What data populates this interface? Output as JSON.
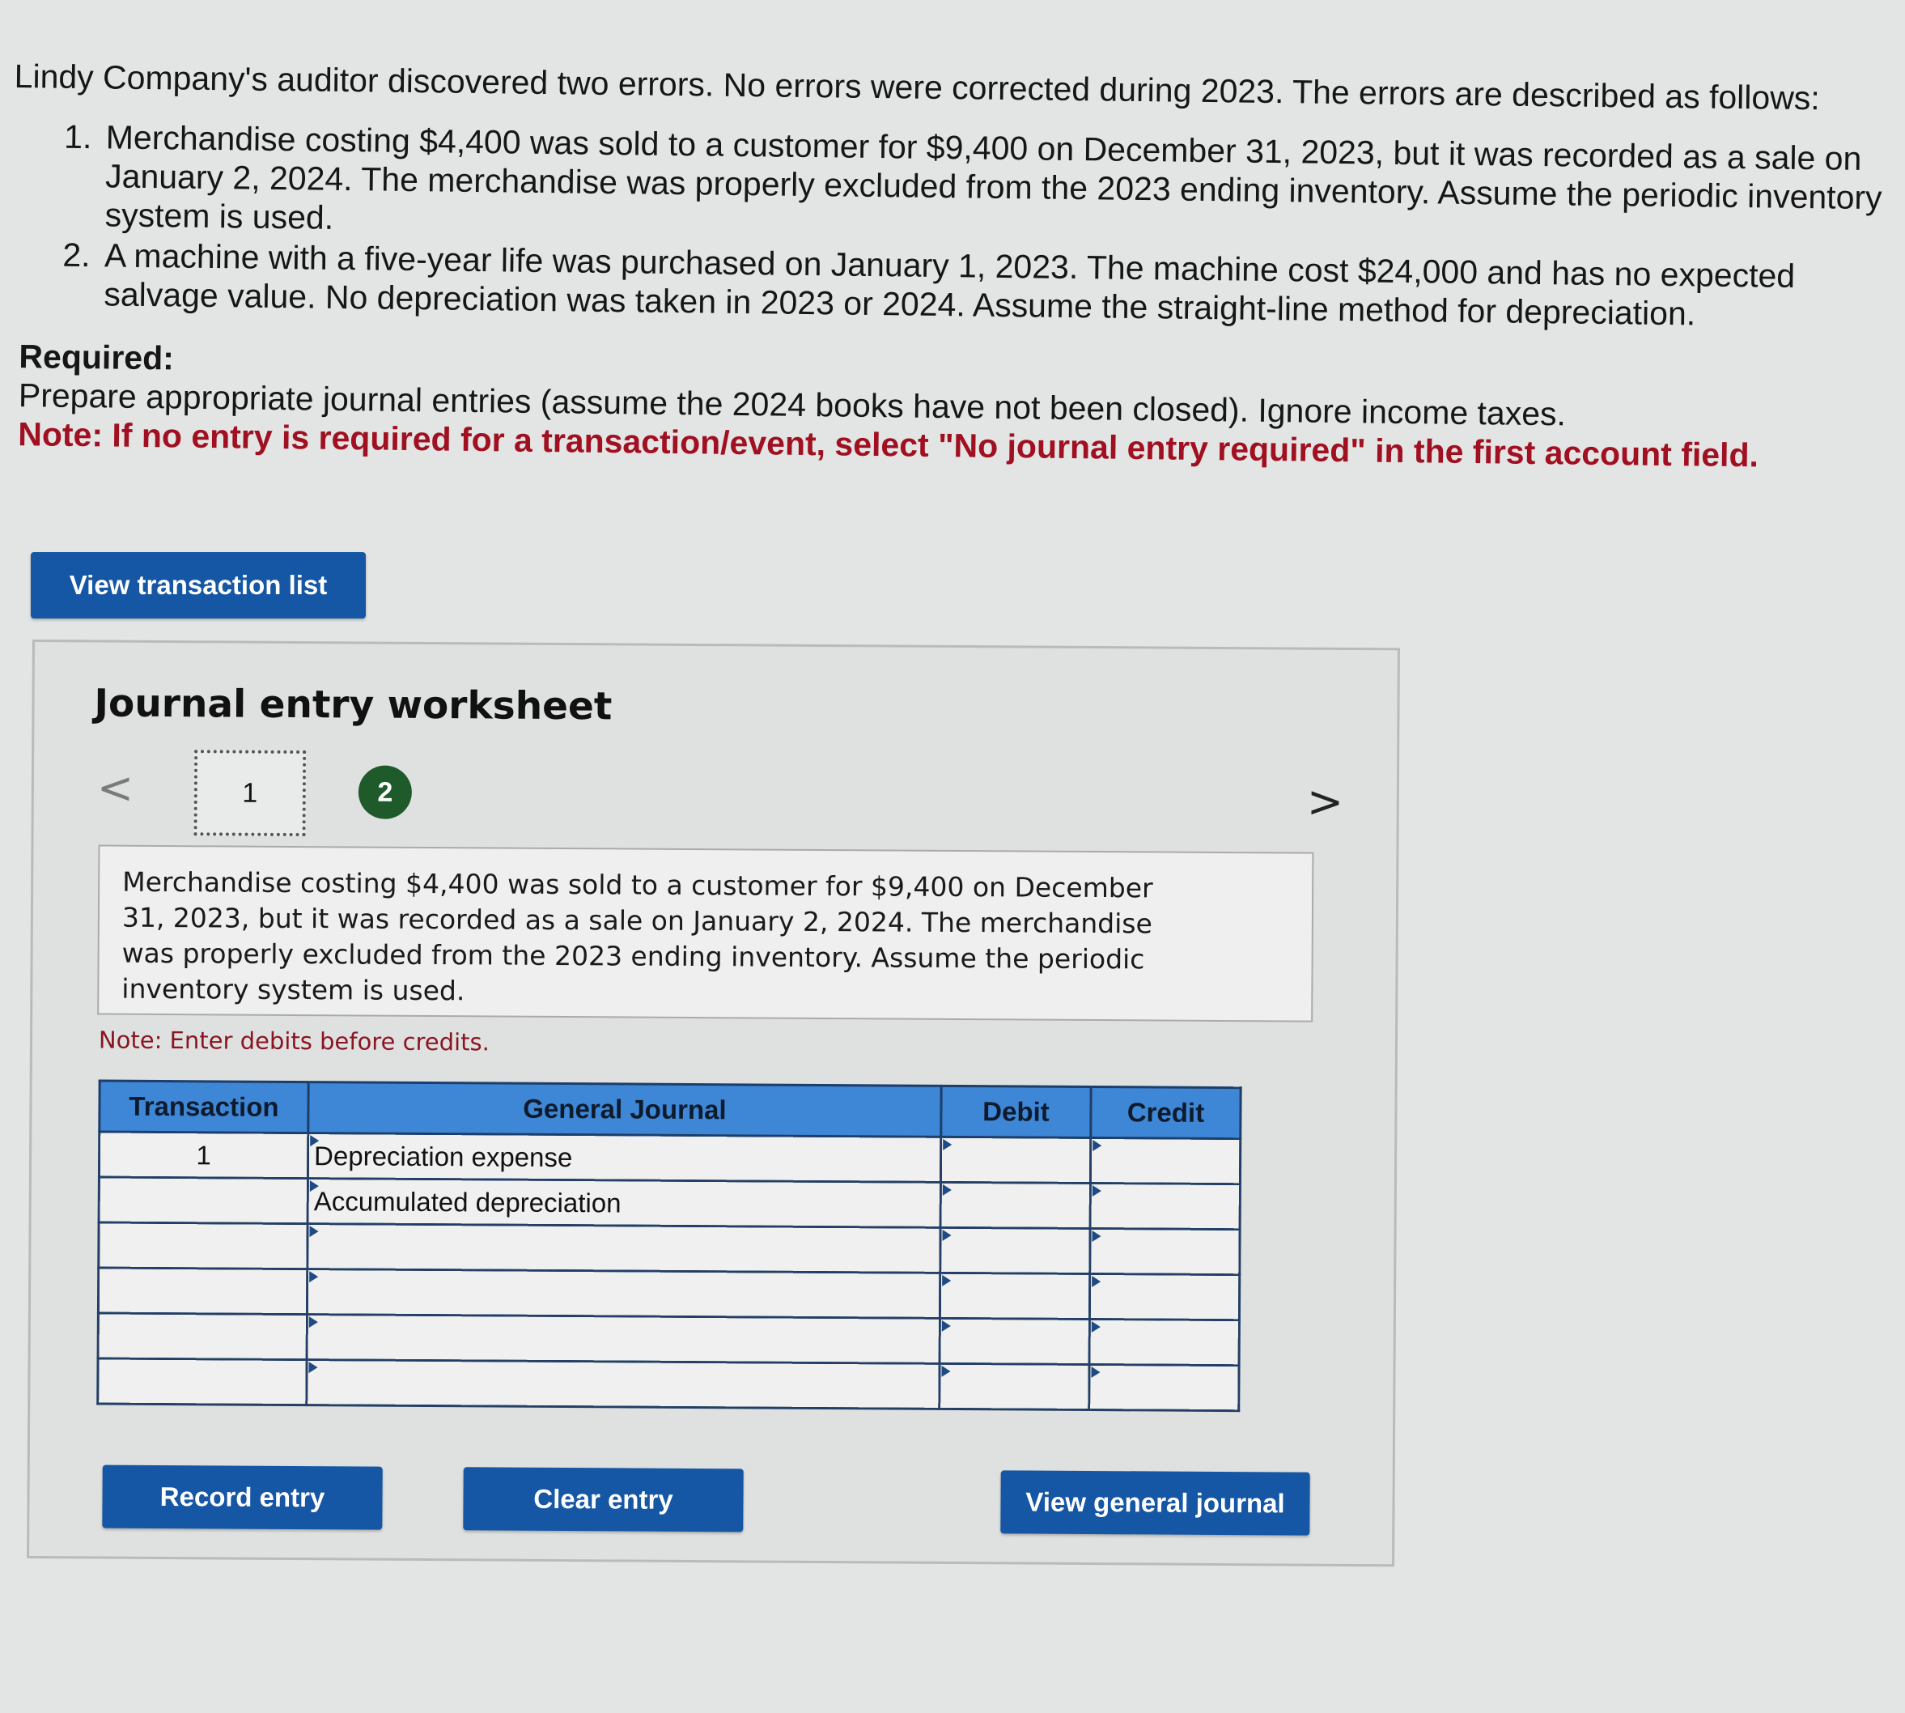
{
  "intro": {
    "lead": "Lindy Company's auditor discovered two errors. No errors were corrected during 2023. The errors are described as follows:",
    "errors": [
      "Merchandise costing $4,400 was sold to a customer for $9,400 on December 31, 2023, but it was recorded as a sale on January 2, 2024. The merchandise was properly excluded from the 2023 ending inventory. Assume the periodic inventory system is used.",
      "A machine with a five-year life was purchased on January 1, 2023. The machine cost $24,000 and has no expected salvage value. No depreciation was taken in 2023 or 2024. Assume the straight-line method for depreciation."
    ],
    "required_heading": "Required:",
    "required_text": "Prepare appropriate journal entries (assume the 2024 books have not been closed). Ignore income taxes.",
    "note": "Note: If no entry is required for a transaction/event, select \"No journal entry required\" in the first account field."
  },
  "buttons": {
    "view_transaction_list": "View transaction list",
    "record_entry": "Record entry",
    "clear_entry": "Clear entry",
    "view_general_journal": "View general journal"
  },
  "worksheet": {
    "title": "Journal entry worksheet",
    "prev_glyph": "<",
    "next_glyph": ">",
    "tabs": [
      {
        "label": "1",
        "state": "current"
      },
      {
        "label": "2",
        "state": "completed"
      }
    ],
    "description": "Merchandise costing $4,400 was sold to a customer for $9,400 on December 31, 2023, but it was recorded as a sale on January 2, 2024. The merchandise was properly excluded from the 2023 ending inventory. Assume the periodic inventory system is used.",
    "note": "Note: Enter debits before credits.",
    "table": {
      "headers": {
        "transaction": "Transaction",
        "general_journal": "General Journal",
        "debit": "Debit",
        "credit": "Credit"
      },
      "rows": [
        {
          "transaction": "1",
          "account": "Depreciation expense",
          "debit": "",
          "credit": ""
        },
        {
          "transaction": "",
          "account": "Accumulated depreciation",
          "debit": "",
          "credit": ""
        },
        {
          "transaction": "",
          "account": "",
          "debit": "",
          "credit": ""
        },
        {
          "transaction": "",
          "account": "",
          "debit": "",
          "credit": ""
        },
        {
          "transaction": "",
          "account": "",
          "debit": "",
          "credit": ""
        },
        {
          "transaction": "",
          "account": "",
          "debit": "",
          "credit": ""
        }
      ]
    }
  },
  "colors": {
    "button_blue": "#1557a4",
    "header_blue": "#3e86d6",
    "note_red": "#a01021",
    "tab_completed_green": "#1f5a2b"
  }
}
